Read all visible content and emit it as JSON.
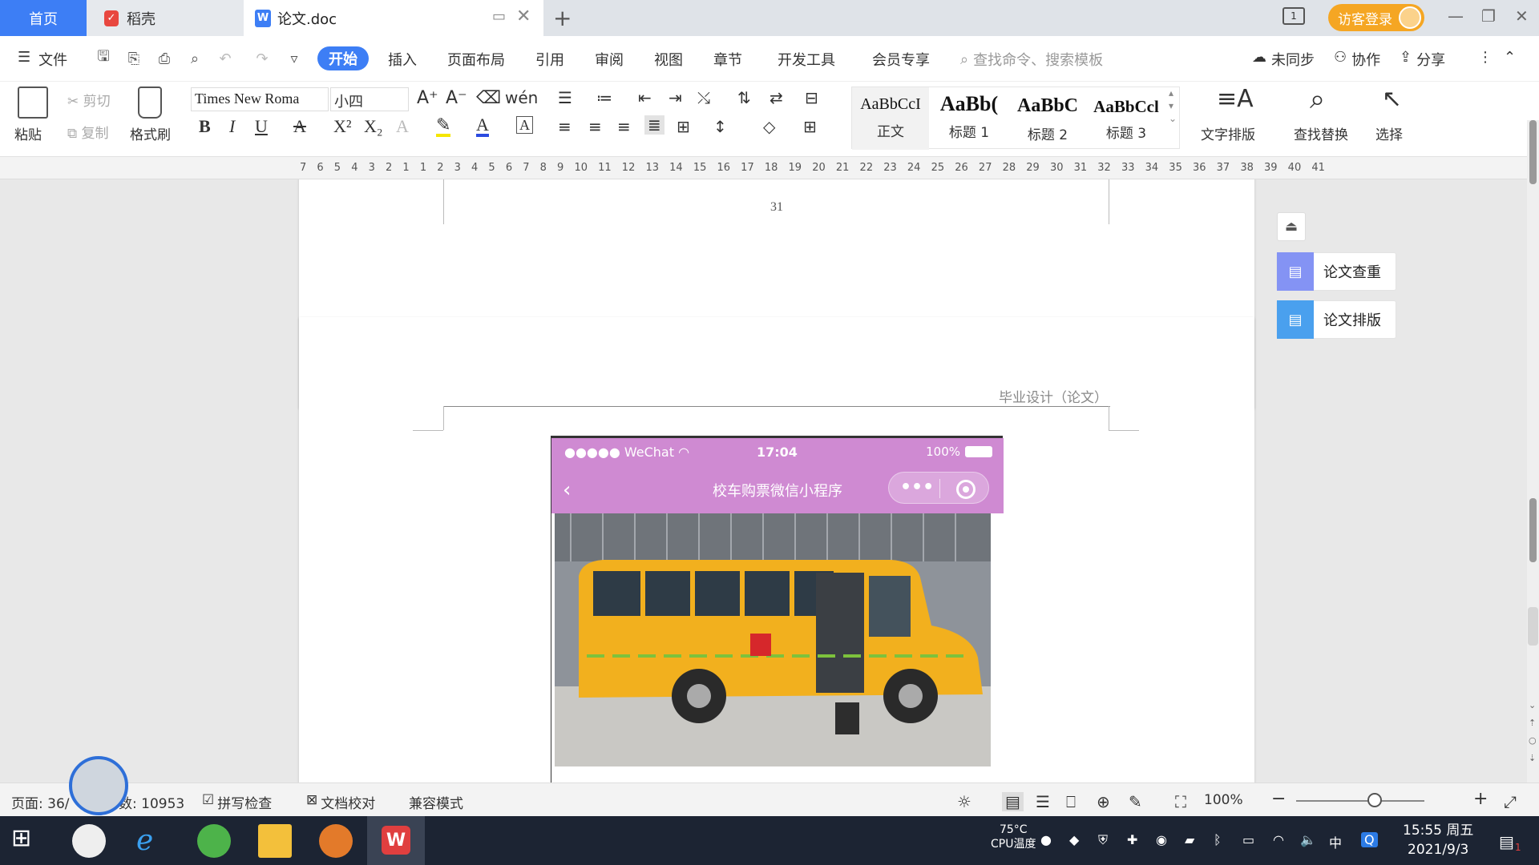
{
  "tabs": {
    "home": "首页",
    "daoke": "稻壳",
    "doc": "论文.doc",
    "guest_login": "访客登录"
  },
  "menu": {
    "file": "文件",
    "items": [
      "开始",
      "插入",
      "页面布局",
      "引用",
      "审阅",
      "视图",
      "章节",
      "开发工具",
      "会员专享"
    ],
    "search_placeholder": "查找命令、搜索模板",
    "sync": "未同步",
    "collab": "协作",
    "share": "分享"
  },
  "ribbon": {
    "paste": "粘贴",
    "cut": "剪切",
    "copy": "复制",
    "format_painter": "格式刷",
    "font_name": "Times New Roma",
    "font_size": "小四",
    "styles": [
      {
        "sample": "AaBbCcI",
        "name": "正文"
      },
      {
        "sample": "AaBb(",
        "name": "标题 1"
      },
      {
        "sample": "AaBbC",
        "name": "标题 2"
      },
      {
        "sample": "AaBbCcl",
        "name": "标题 3"
      }
    ],
    "text_layout": "文字排版",
    "find_replace": "查找替换",
    "select": "选择"
  },
  "ruler": {
    "numbers": "7 6 5 4 3 2 1 1 2 3 4 5 6 7 8 9 10 11 12 13 14 15 16 17 18 19 20 21 22 23 24 25 26 27 28 29 30 31 32 33 34 35 36 37 38 39 40 41"
  },
  "document": {
    "page_number": "31",
    "header": "毕业设计（论文）",
    "phone": {
      "carrier": "●●●●● WeChat",
      "time": "17:04",
      "battery": "100%",
      "title": "校车购票微信小程序",
      "more": "•••"
    }
  },
  "side_panel": {
    "check": "论文查重",
    "layout": "论文排版"
  },
  "status": {
    "page": "页面: 36/",
    "words": "数: 10953",
    "spell_check": "拼写检查",
    "doc_proof": "文档校对",
    "compat": "兼容模式",
    "zoom": "100%"
  },
  "taskbar": {
    "cpu_temp": "75°C",
    "cpu_label": "CPU温度",
    "ime": "中",
    "time": "15:55 周五",
    "date": "2021/9/3",
    "notif_count": "1"
  },
  "colors": {
    "accent": "#3d7ef5",
    "guest": "#f5a623",
    "wechat_bar": "#cf8ad2",
    "bus_yellow": "#f2b01e",
    "side_icon": "#6f8cf0"
  }
}
